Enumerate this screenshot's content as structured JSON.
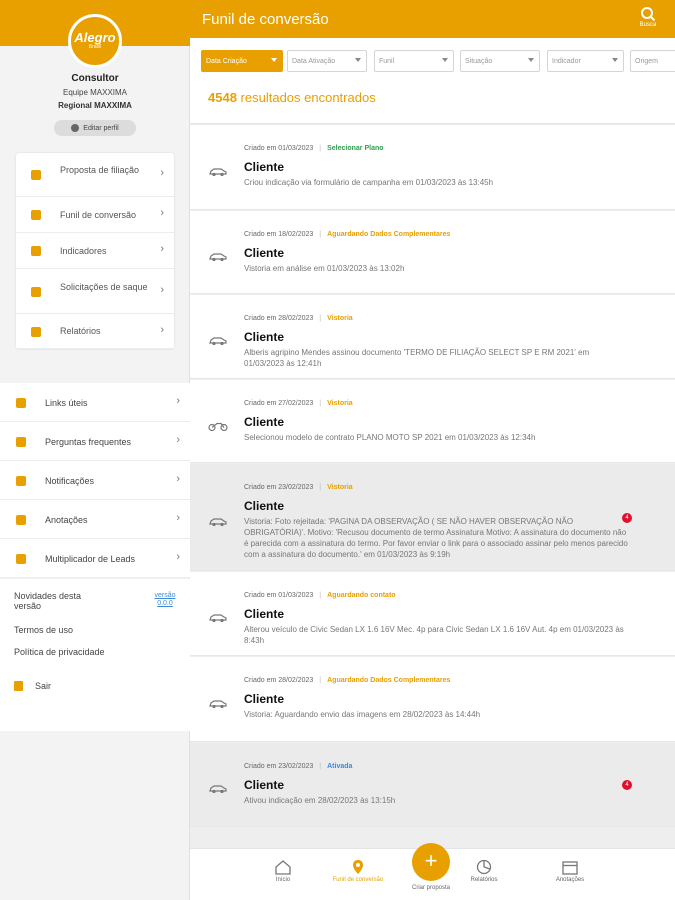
{
  "brand": {
    "logo_text": "Alegro",
    "logo_sub": "Brasil",
    "primary": "#e8a000"
  },
  "profile": {
    "role": "Consultor",
    "team": "Equipe MAXXIMA",
    "regional": "Regional MAXXIMA",
    "edit_label": "Editar perfil"
  },
  "sidebar": {
    "menu": [
      {
        "label": "Proposta de filiação",
        "icon": "document-icon"
      },
      {
        "label": "Funil de conversão",
        "icon": "location-pin-icon"
      },
      {
        "label": "Indicadores",
        "icon": "people-icon"
      },
      {
        "label": "Solicitações de saque",
        "icon": "money-hand-icon"
      },
      {
        "label": "Relatórios",
        "icon": "pie-chart-icon"
      }
    ],
    "links": [
      {
        "label": "Links úteis",
        "icon": "link-icon"
      },
      {
        "label": "Perguntas frequentes",
        "icon": "chat-icon"
      },
      {
        "label": "Notificações",
        "icon": "bell-icon"
      },
      {
        "label": "Anotações",
        "icon": "calendar-icon"
      },
      {
        "label": "Multiplicador de Leads",
        "icon": "user-plus-icon"
      }
    ],
    "news_label": "Novidades desta versão",
    "version_label": "versão 0.0.0",
    "terms_label": "Termos de uso",
    "privacy_label": "Política de privacidade",
    "exit_label": "Sair"
  },
  "header": {
    "title": "Funil de conversão",
    "search_label": "Busca"
  },
  "filters": [
    {
      "label": "Data Criação",
      "active": true
    },
    {
      "label": "Data Ativação",
      "active": false
    },
    {
      "label": "Funil",
      "active": false
    },
    {
      "label": "Situação",
      "active": false
    },
    {
      "label": "Indicador",
      "active": false
    },
    {
      "label": "Origem",
      "active": false
    }
  ],
  "results": {
    "count": "4548",
    "label": "resultados encontrados"
  },
  "status_colors": {
    "green": "#2e9e4f",
    "orange": "#e8a000",
    "blue": "#3a8bd8"
  },
  "feed": [
    {
      "created": "Criado em 01/03/2023",
      "status": "Selecionar Plano",
      "status_color": "#2e9e4f",
      "name": "Cliente",
      "desc": "Criou indicação via formulário de campanha em 01/03/2023 às 13:45h",
      "vehicle": "car-icon",
      "selected": false,
      "badge": ""
    },
    {
      "created": "Criado em 18/02/2023",
      "status": "Aguardando Dados Complementares",
      "status_color": "#e8a000",
      "name": "Cliente",
      "desc": "Vistoria em análise em 01/03/2023 às 13:02h",
      "vehicle": "car-icon",
      "selected": false,
      "badge": ""
    },
    {
      "created": "Criado em 28/02/2023",
      "status": "Vistoria",
      "status_color": "#e8a000",
      "name": "Cliente",
      "desc": "Alberis agripino Mendes assinou documento 'TERMO DE FILIAÇÃO SELECT SP E RM 2021' em 01/03/2023 às 12:41h",
      "vehicle": "car-icon",
      "selected": false,
      "badge": ""
    },
    {
      "created": "Criado em 27/02/2023",
      "status": "Vistoria",
      "status_color": "#e8a000",
      "name": "Cliente",
      "desc": "Selecionou modelo de contrato PLANO MOTO SP 2021 em 01/03/2023 às 12:34h",
      "vehicle": "motorcycle-icon",
      "selected": false,
      "badge": ""
    },
    {
      "created": "Criado em 23/02/2023",
      "status": "Vistoria",
      "status_color": "#e8a000",
      "name": "Cliente",
      "desc": "Vistoria: Foto rejeitada: 'PAGINA DA OBSERVAÇÃO ( SE NÃO HAVER OBSERVAÇÃO NÃO OBRIGATÓRIA)'. Motivo: 'Recusou documento de termo Assinatura Motivo: A assinatura do documento não é parecida com a assinatura do termo. Por favor enviar o link para o associado assinar pelo menos parecido com a assinatura do documento.' em 01/03/2023 às 9:19h",
      "vehicle": "car-icon",
      "selected": true,
      "badge": "4"
    },
    {
      "created": "Criado em 01/03/2023",
      "status": "Aguardando contato",
      "status_color": "#e8a000",
      "name": "Cliente",
      "desc": "Alterou veículo de Civic Sedan LX 1.6 16V Mec. 4p para Civic Sedan LX 1.6 16V Aut. 4p em 01/03/2023 às 8:43h",
      "vehicle": "car-icon",
      "selected": false,
      "badge": ""
    },
    {
      "created": "Criado em 28/02/2023",
      "status": "Aguardando Dados Complementares",
      "status_color": "#e8a000",
      "name": "Cliente",
      "desc": "Vistoria: Aguardando envio das imagens em 28/02/2023 às 14:44h",
      "vehicle": "car-icon",
      "selected": false,
      "badge": ""
    },
    {
      "created": "Criado em 23/02/2023",
      "status": "Ativada",
      "status_color": "#3a8bd8",
      "name": "Cliente",
      "desc": "Ativou indicação em 28/02/2023 às 13:15h",
      "vehicle": "car-icon",
      "selected": true,
      "badge": "4"
    }
  ],
  "bottom_nav": {
    "items": [
      {
        "label": "Início",
        "icon": "home-icon",
        "active": false
      },
      {
        "label": "Funil de conversão",
        "icon": "funnel-pin-icon",
        "active": true
      },
      {
        "label": "Relatórios",
        "icon": "pie-chart-icon",
        "active": false
      },
      {
        "label": "Anotações",
        "icon": "calendar-icon",
        "active": false
      }
    ],
    "fab_label": "Criar proposta",
    "fab_symbol": "+"
  }
}
